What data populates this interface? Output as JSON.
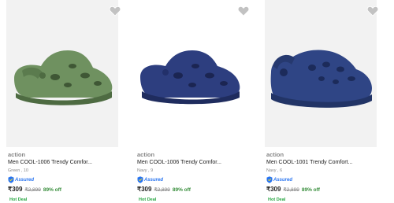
{
  "products": [
    {
      "brand": "action",
      "title": "Men COOL-1006 Trendy Comfor...",
      "variant": "Green , 10",
      "assured": "Assured",
      "price": "₹309",
      "mrp": "₹2,899",
      "discount": "89% off",
      "deal": "Hot Deal",
      "color": "#6f9160",
      "icon": "green-clog"
    },
    {
      "brand": "action",
      "title": "Men COOL-1006 Trendy Comfor...",
      "variant": "Navy , 9",
      "assured": "Assured",
      "price": "₹309",
      "mrp": "₹2,899",
      "discount": "89% off",
      "deal": "Hot Deal",
      "color": "#2d3e7f",
      "icon": "navy-clog"
    },
    {
      "brand": "action",
      "title": "Men COOL-1001 Trendy Comfort...",
      "variant": "Navy , 6",
      "assured": "Assured",
      "price": "₹309",
      "mrp": "₹2,899",
      "discount": "89% off",
      "deal": "Hot Deal",
      "color": "#2f4585",
      "icon": "navy-clog"
    }
  ]
}
